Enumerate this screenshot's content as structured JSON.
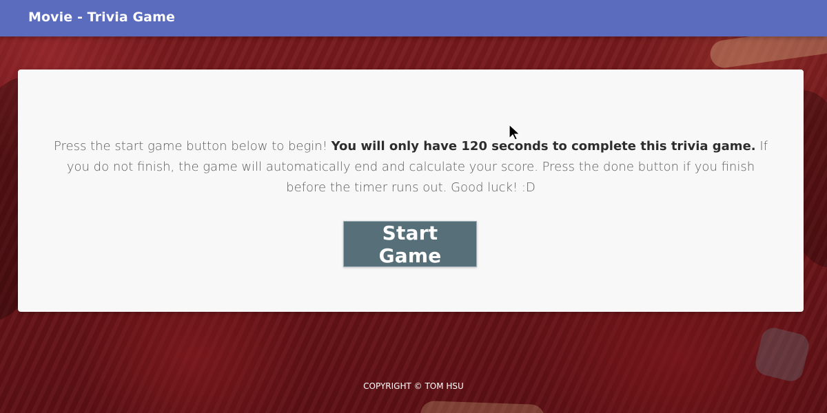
{
  "header": {
    "title": "Movie - Trivia Game"
  },
  "intro": {
    "text_before": "Press the start game button below to begin! ",
    "text_emphasis": "You will only have 120 seconds to complete this trivia game.",
    "text_after": " If you do not finish, the game will automatically end and calculate your score. Press the done button if you finish before the timer runs out. Good luck! :D"
  },
  "actions": {
    "start_label": "Start Game"
  },
  "footer": {
    "copyright": "COPYRIGHT © TOM HSU"
  },
  "colors": {
    "header_bg": "#5b6bbd",
    "card_bg": "#f8f8f8",
    "button_bg": "#566f79",
    "background": "#6b1518"
  },
  "icons": {
    "cursor": "mouse-pointer-icon"
  }
}
